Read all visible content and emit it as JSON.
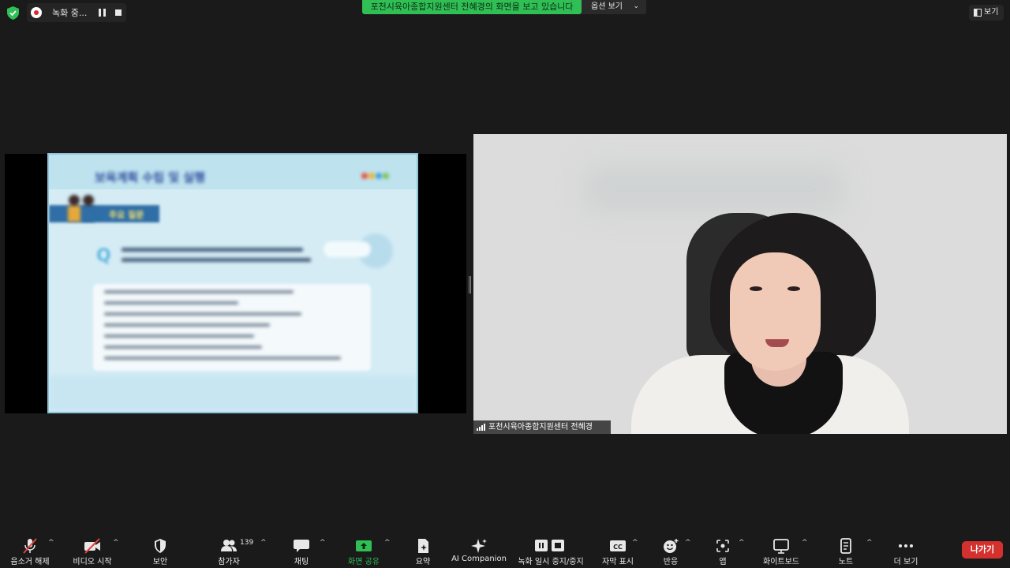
{
  "recording": {
    "label": "녹화 중..."
  },
  "sharing_banner": {
    "text": "포천시육아종합지원센터 전혜경의 화면을 보고 있습니다"
  },
  "view_options": {
    "label": "옵션 보기"
  },
  "view_button": {
    "label": "보기"
  },
  "participant": {
    "name": "포천시육아종합지원센터 전혜경"
  },
  "toolbar": {
    "unmute": "음소거 해제",
    "start_video": "비디오 시작",
    "security": "보안",
    "participants": "참가자",
    "participants_count": "139",
    "chat": "채팅",
    "share_screen": "화면 공유",
    "summary": "요약",
    "ai_companion": "AI Companion",
    "recording_controls": "녹화 일시 중지/중지",
    "captions": "자막 표시",
    "reactions": "반응",
    "apps": "앱",
    "whiteboard": "화이트보드",
    "notes": "노트",
    "more": "더 보기",
    "leave": "나가기"
  },
  "colors": {
    "share_green": "#2fbf55",
    "leave_red": "#d3312e",
    "muted_red": "#e0443c",
    "background": "#1a1a1a"
  }
}
